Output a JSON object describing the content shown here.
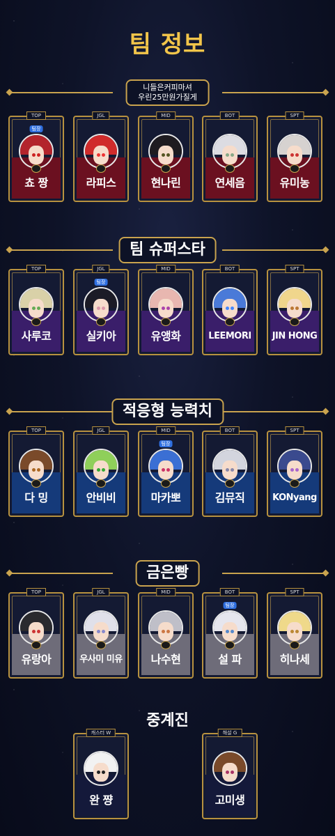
{
  "page_title": "팀 정보",
  "colors": {
    "accent_gold": "#c9a34e",
    "title_gold": "#f2c54a",
    "badge_blue": "#2f6fe0"
  },
  "captain_badge": "팀장",
  "teams": [
    {
      "title": "니들은커피마셔\n우린25만원가질게",
      "band": "#6b1020",
      "players": [
        {
          "pos": "TOP",
          "name": "쵸 짱",
          "captain": true,
          "hair": "#b3242c",
          "eye": "#c22"
        },
        {
          "pos": "JGL",
          "name": "라피스",
          "captain": false,
          "hair": "#d02b2b",
          "eye": "#e33"
        },
        {
          "pos": "MID",
          "name": "현나린",
          "captain": false,
          "hair": "#1e1b20",
          "eye": "#552"
        },
        {
          "pos": "BOT",
          "name": "연세음",
          "captain": false,
          "hair": "#dcdce2",
          "eye": "#8a8"
        },
        {
          "pos": "SPT",
          "name": "유미농",
          "captain": false,
          "hair": "#d6d2d0",
          "eye": "#c33"
        }
      ]
    },
    {
      "title": "팀 슈퍼스타",
      "band": "#3a1e6a",
      "players": [
        {
          "pos": "TOP",
          "name": "사루코",
          "captain": false,
          "hair": "#d9d1a8",
          "eye": "#6a5"
        },
        {
          "pos": "JGL",
          "name": "실키아",
          "captain": true,
          "hair": "#1b1b26",
          "eye": "#d9a"
        },
        {
          "pos": "MID",
          "name": "유앵화",
          "captain": false,
          "hair": "#e8b7b0",
          "eye": "#a4a"
        },
        {
          "pos": "BOT",
          "name": "LEEMORI",
          "captain": false,
          "hair": "#4a7ad8",
          "eye": "#48f"
        },
        {
          "pos": "SPT",
          "name": "JIN HONG",
          "captain": false,
          "hair": "#f0d68c",
          "eye": "#b73"
        }
      ]
    },
    {
      "title": "적응형 능력치",
      "band": "#153a7a",
      "players": [
        {
          "pos": "TOP",
          "name": "다 밍",
          "captain": false,
          "hair": "#7a4a2a",
          "eye": "#a62"
        },
        {
          "pos": "JGL",
          "name": "안비비",
          "captain": false,
          "hair": "#8fcf5a",
          "eye": "#3a3"
        },
        {
          "pos": "MID",
          "name": "마카뽀",
          "captain": true,
          "hair": "#3b6fd4",
          "eye": "#c36"
        },
        {
          "pos": "BOT",
          "name": "김뮤직",
          "captain": false,
          "hair": "#d3d5de",
          "eye": "#88a"
        },
        {
          "pos": "SPT",
          "name": "KONyang",
          "captain": false,
          "hair": "#3a4a8e",
          "eye": "#a6c"
        }
      ]
    },
    {
      "title": "금은빵",
      "band": "#6e6c79",
      "players": [
        {
          "pos": "TOP",
          "name": "유랑아",
          "captain": false,
          "hair": "#2a2a2e",
          "eye": "#c33"
        },
        {
          "pos": "JGL",
          "name": "우사미 미유",
          "captain": false,
          "hair": "#e0e0ea",
          "eye": "#88c"
        },
        {
          "pos": "MID",
          "name": "나수현",
          "captain": false,
          "hair": "#bfbfc8",
          "eye": "#c74"
        },
        {
          "pos": "BOT",
          "name": "설 파",
          "captain": true,
          "hair": "#e6e6ee",
          "eye": "#58c"
        },
        {
          "pos": "SPT",
          "name": "히나세",
          "captain": false,
          "hair": "#efd98a",
          "eye": "#b83"
        }
      ]
    }
  ],
  "broadcast": {
    "title": "중계진",
    "band": "#14193a",
    "members": [
      {
        "pos": "캐스터 W",
        "name": "완 쨩",
        "hair": "#f2f2f2",
        "eye": "#222"
      },
      {
        "pos": "해설 G",
        "name": "고미생",
        "hair": "#7a4a2a",
        "eye": "#a36"
      }
    ]
  }
}
